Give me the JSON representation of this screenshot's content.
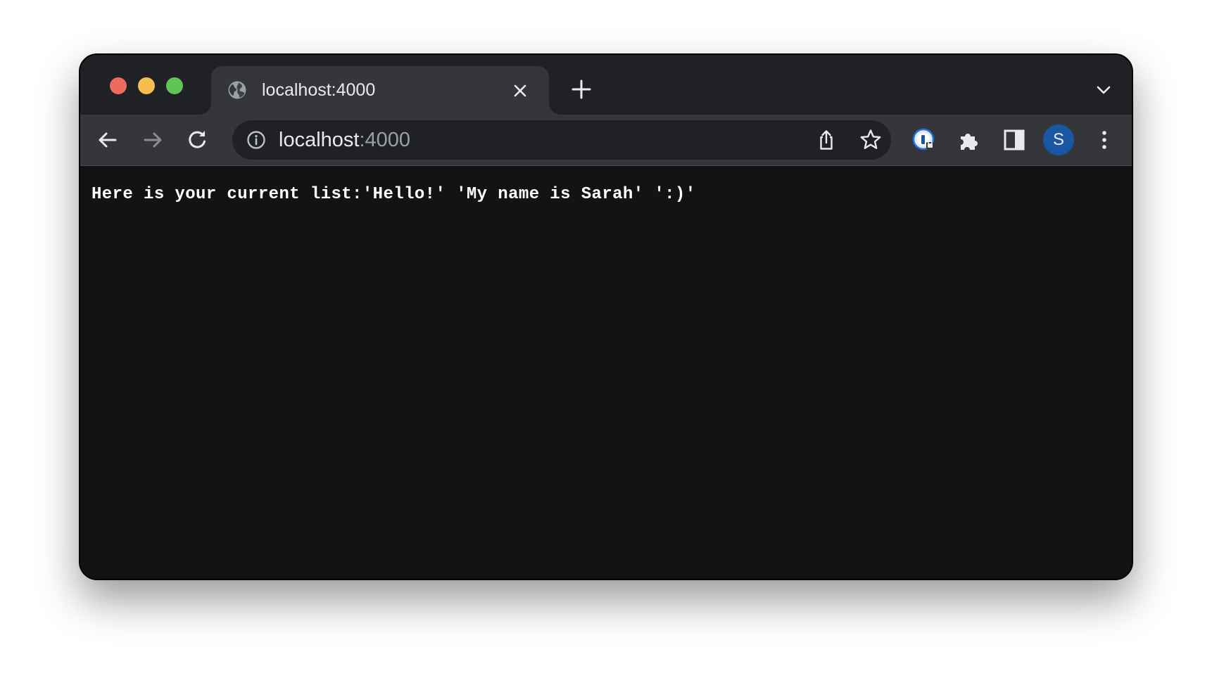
{
  "window": {
    "tab": {
      "title": "localhost:4000"
    },
    "toolbar": {
      "url_host": "localhost",
      "url_port": ":4000",
      "profile_initial": "S"
    }
  },
  "page": {
    "text": "Here is your current list:'Hello!' 'My name is Sarah' ':)'"
  },
  "colors": {
    "page_background": "#131313",
    "tab_strip": "#202124",
    "toolbar": "#35363a",
    "profile_avatar": "#1a57a3",
    "close_light": "#ed6a5e",
    "minimize_light": "#f4bf4f",
    "maximize_light": "#61c554"
  },
  "icons": {
    "tab_favicon": "globe-icon",
    "tab_close": "close-icon",
    "new_tab": "plus-icon",
    "tab_search": "chevron-down-icon",
    "back": "arrow-left-icon",
    "forward": "arrow-right-icon",
    "reload": "reload-icon",
    "site_info": "info-icon",
    "share": "share-icon",
    "bookmark": "star-icon",
    "password_manager": "password-manager-icon",
    "extensions": "puzzle-icon",
    "side_panel": "side-panel-icon",
    "menu": "kebab-menu-icon"
  }
}
